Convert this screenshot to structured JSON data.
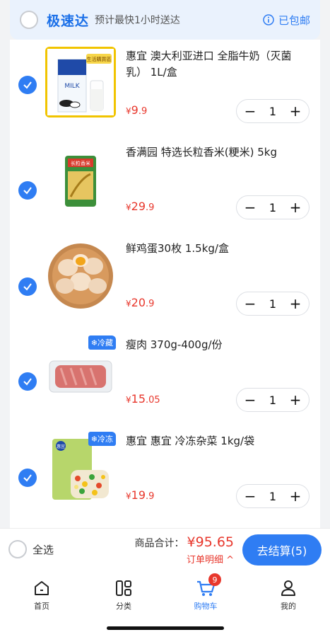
{
  "header": {
    "brand": "极速达",
    "eta": "预计最快1小时送达",
    "free_shipping": "已包邮"
  },
  "items": [
    {
      "name": "惠宜 澳大利亚进口 全脂牛奶（灭菌乳） 1L/盒",
      "currency": "¥",
      "price_int": "9",
      "price_dec": ".9",
      "qty": "1",
      "tag": ""
    },
    {
      "name": "香满园 特选长粒香米(粳米) 5kg",
      "currency": "¥",
      "price_int": "29",
      "price_dec": ".9",
      "qty": "1",
      "tag": ""
    },
    {
      "name": "鲜鸡蛋30枚 1.5kg/盒",
      "currency": "¥",
      "price_int": "20",
      "price_dec": ".9",
      "qty": "1",
      "tag": ""
    },
    {
      "name": "瘦肉 370g-400g/份",
      "currency": "¥",
      "price_int": "15",
      "price_dec": ".05",
      "qty": "1",
      "tag": "❄冷藏"
    },
    {
      "name": "惠宜 惠宜 冷冻杂菜 1kg/袋",
      "currency": "¥",
      "price_int": "19",
      "price_dec": ".9",
      "qty": "1",
      "tag": "❄冷冻"
    }
  ],
  "product_art": {
    "milk_brand_text": "MILK",
    "milk_box_caption": "生活購買區",
    "rice_bag_text": "长粒香米",
    "veg_brand_text": "惠宜"
  },
  "cart": {
    "select_all": "全选",
    "total_label": "商品合计：",
    "total_value": "¥95.65",
    "detail_label": "订单明细 ^",
    "checkout_label": "去结算(5)"
  },
  "tabs": [
    {
      "label": "首页",
      "icon": "home-icon"
    },
    {
      "label": "分类",
      "icon": "category-icon"
    },
    {
      "label": "购物车",
      "icon": "cart-icon",
      "badge": "9",
      "active": true
    },
    {
      "label": "我的",
      "icon": "profile-icon"
    }
  ],
  "colors": {
    "accent": "#2f7df3",
    "price": "#e8372c",
    "brand_text": "#1a6fe8"
  }
}
